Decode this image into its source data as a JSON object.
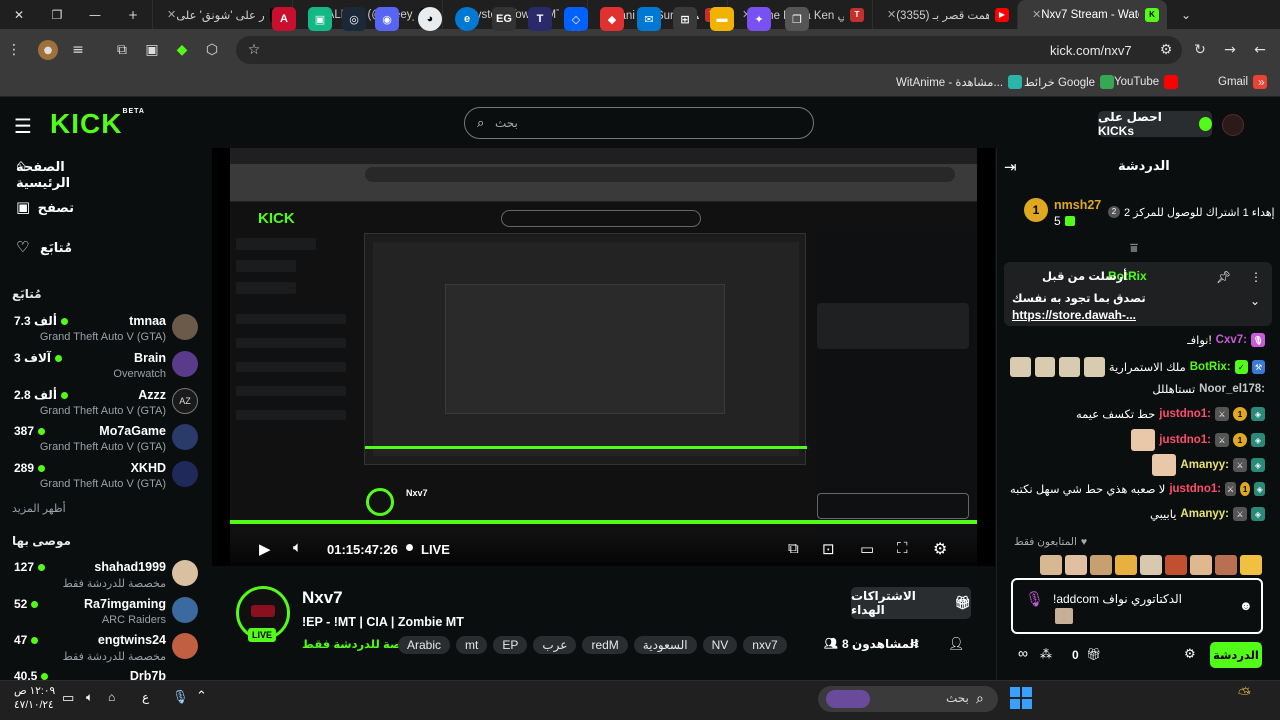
{
  "browser": {
    "tabs": [
      {
        "label": "اعتر على 'شونق' على",
        "close": "✕"
      },
      {
        "label": "WALEED (@wleey_20",
        "close": "✕"
      },
      {
        "label": "Mystery Town - MT S",
        "close": "✕"
      },
      {
        "label": "Nani wo Suru انمي",
        "close": "✕"
      },
      {
        "label": "Slime Datta Ken انمي",
        "close": "✕"
      },
      {
        "label": "(3355) داهمت قصر بـ",
        "close": "✕"
      },
      {
        "label": "Nxv7 Stream - Watch",
        "close": "✕"
      }
    ],
    "new_tab": "+",
    "url": "kick.com/nxv7",
    "bookmarks": [
      {
        "label": "WitAnime - مشاهدة...",
        "color": "#2bb5a8"
      },
      {
        "label": "خرائط Google",
        "color": "#34a853"
      },
      {
        "label": "YouTube",
        "color": "#ff0000"
      },
      {
        "label": "Gmail",
        "color": "#ea4335"
      }
    ]
  },
  "kick": {
    "logo": "KICK",
    "logo_beta": "BETA",
    "search_placeholder": "بحث",
    "get_kicks_label": "احصل على KICKs",
    "nav": [
      {
        "label": "الصفحة الرئيسية",
        "icon": "home-icon"
      },
      {
        "label": "تصفح",
        "icon": "browse-icon"
      },
      {
        "label": "مُتابَع",
        "icon": "heart-icon"
      }
    ],
    "following_header": "مُتابَع",
    "channels": [
      {
        "name": "tmnaa",
        "category": "Grand Theft Auto V (GTA)",
        "viewers": "7.3 ألف",
        "color": "#6b5a4a"
      },
      {
        "name": "Brain",
        "category": "Overwatch",
        "viewers": "3 آلاف",
        "color": "#5a3a8a"
      },
      {
        "name": "Azzz",
        "category": "Grand Theft Auto V (GTA)",
        "viewers": "2.8 ألف",
        "color": "#1a1a1a"
      },
      {
        "name": "Mo7aGame",
        "category": "Grand Theft Auto V (GTA)",
        "viewers": "387",
        "color": "#2a3a6a"
      },
      {
        "name": "XKHD",
        "category": "Grand Theft Auto V (GTA)",
        "viewers": "289",
        "color": "#1f2a5a"
      }
    ],
    "show_more": "أظهر المزيد",
    "recommended_header": "موصى بها",
    "recommended": [
      {
        "name": "shahad1999",
        "category": "مخصصة للدردشة فقط",
        "viewers": "127",
        "color": "#d8c0a0"
      },
      {
        "name": "Ra7imgaming",
        "category": "ARC Raiders",
        "viewers": "52",
        "color": "#3a6aa0"
      },
      {
        "name": "engtwins24",
        "category": "مخصصة للدردشة فقط",
        "viewers": "47",
        "color": "#c06040"
      },
      {
        "name": "Drb7b",
        "category": "",
        "viewers": "40.5",
        "color": "#5a5a5a"
      }
    ],
    "player": {
      "time": "01:15:47:26",
      "live": "LIVE"
    },
    "stream": {
      "name": "Nxv7",
      "title": "!EP - !MT | CIA | Zombie MT",
      "category": "مخصصة للدردشة فقط",
      "tags": [
        "Arabic",
        "mt",
        "EP",
        "عرب",
        "redM",
        "السعودية",
        "NV",
        "nxv7"
      ],
      "live_badge": "LIVE",
      "viewers": "8 المشاهدون",
      "martyr_subs_label": "الاشتراكات الهداء"
    },
    "chat": {
      "header": "الدردشة",
      "gift_text": "إهداء 1 اشتراك للوصول للمركز 2",
      "gift_rank": "2",
      "gift_user": "nmsh27",
      "gift_count": "5",
      "gift_level": "1",
      "pinned_label": "أرسلت من قبل",
      "pinned_by": "BotRix",
      "pinned_msg": "تصدق بما تجود به نفسك",
      "pinned_link": "https://store.dawah-...",
      "messages": [
        {
          "user": "Cxv7:",
          "text": "نوافـ!",
          "color": "#c85bd8"
        },
        {
          "user": "BotRix:",
          "text": "ملك الاستمرارية",
          "color": "#53fc18"
        },
        {
          "user": "Noor_el178:",
          "text": "تستاهللل",
          "color": "#c7c7c7"
        },
        {
          "user": "justdno1:",
          "text": "حط تكسف عيمه",
          "color": "#ff4d6a"
        },
        {
          "user": "justdno1:",
          "text": "",
          "color": "#ff4d6a"
        },
        {
          "user": "Amanyy:",
          "text": "",
          "color": "#e8e36b"
        },
        {
          "user": "justdno1:",
          "text": "لا صعبه هذي حط شي سهل نكتبه",
          "color": "#ff4d6a"
        },
        {
          "user": "Amanyy:",
          "text": "يابيبي",
          "color": "#e8e36b"
        }
      ],
      "followers_only": "المتابعون فقط",
      "input_text": "!addcom الدكتاتوري نواف",
      "send_label": "الدردشة",
      "points": "0"
    }
  },
  "taskbar": {
    "time": "١٢:٠٩ ص",
    "date": "٤٧/١٠/٢٤",
    "lang": "ع",
    "search": "بحث"
  }
}
